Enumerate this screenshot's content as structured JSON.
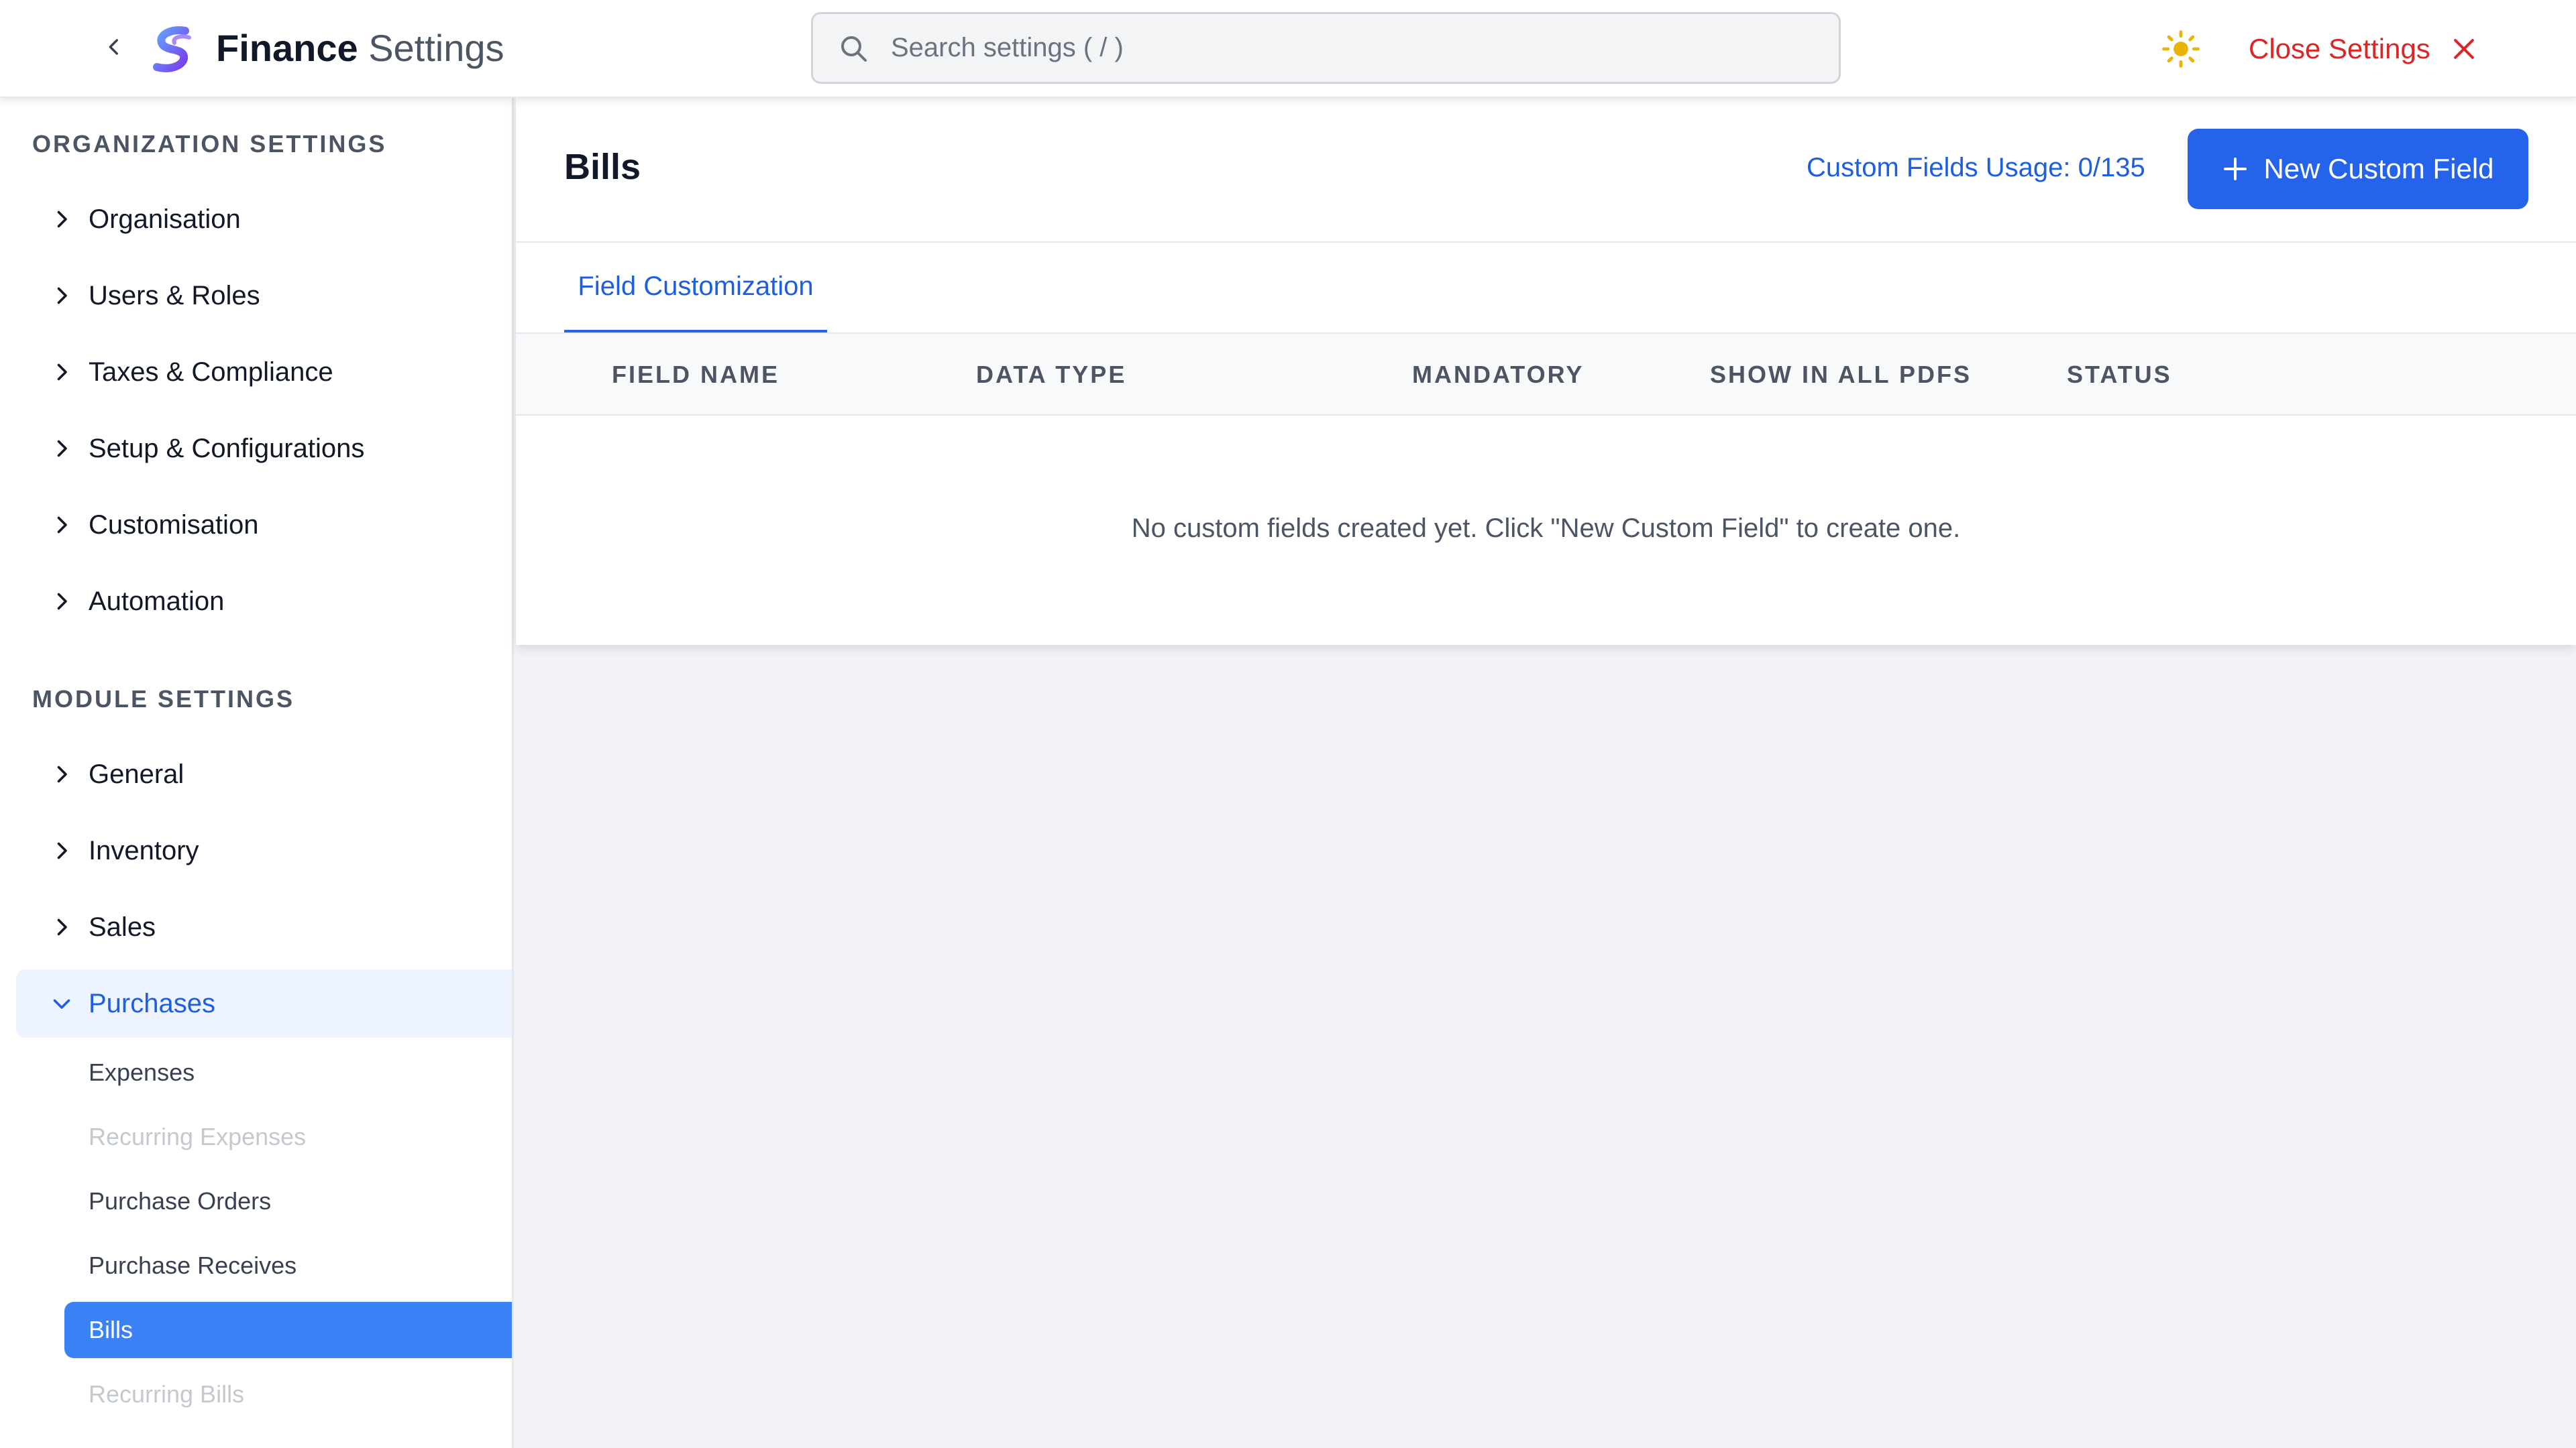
{
  "header": {
    "title_strong": "Finance",
    "title_light": "Settings",
    "search_placeholder": "Search settings ( / )",
    "close_label": "Close Settings"
  },
  "sidebar": {
    "org_title": "ORGANIZATION SETTINGS",
    "org_items": [
      {
        "label": "Organisation"
      },
      {
        "label": "Users & Roles"
      },
      {
        "label": "Taxes & Compliance"
      },
      {
        "label": "Setup & Configurations"
      },
      {
        "label": "Customisation"
      },
      {
        "label": "Automation"
      }
    ],
    "module_title": "MODULE SETTINGS",
    "module_items": [
      {
        "label": "General"
      },
      {
        "label": "Inventory"
      },
      {
        "label": "Sales"
      },
      {
        "label": "Purchases"
      }
    ],
    "purchase_subitems": [
      {
        "label": "Expenses"
      },
      {
        "label": "Recurring Expenses"
      },
      {
        "label": "Purchase Orders"
      },
      {
        "label": "Purchase Receives"
      },
      {
        "label": "Bills"
      },
      {
        "label": "Recurring Bills"
      }
    ]
  },
  "main": {
    "title": "Bills",
    "usage": "Custom Fields Usage: 0/135",
    "new_button": "New Custom Field",
    "tab": "Field Customization",
    "columns": [
      "FIELD NAME",
      "DATA TYPE",
      "MANDATORY",
      "SHOW IN ALL PDFS",
      "STATUS"
    ],
    "empty_message": "No custom fields created yet. Click \"New Custom Field\" to create one."
  },
  "colors": {
    "accent": "#2563eb",
    "close": "#dc2626",
    "sun": "#eab308",
    "active_item": "#3b82f6"
  }
}
